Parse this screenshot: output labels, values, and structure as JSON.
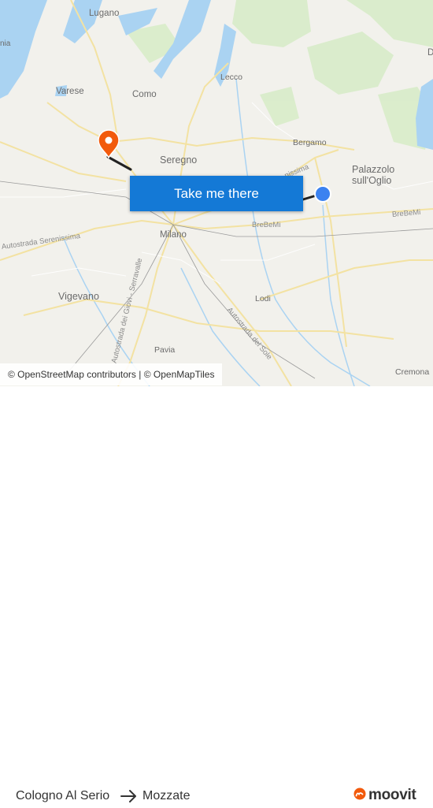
{
  "map": {
    "places": [
      {
        "id": "lugano",
        "label": "Lugano"
      },
      {
        "id": "varese",
        "label": "Varese"
      },
      {
        "id": "como",
        "label": "Como"
      },
      {
        "id": "lecco",
        "label": "Lecco"
      },
      {
        "id": "bergamo",
        "label": "Bergamo"
      },
      {
        "id": "palazzolo",
        "label": "Palazzolo\nsull'Oglio"
      },
      {
        "id": "seregno",
        "label": "Seregno"
      },
      {
        "id": "milano",
        "label": "Milano"
      },
      {
        "id": "vigevano",
        "label": "Vigevano"
      },
      {
        "id": "lodi",
        "label": "Lodi"
      },
      {
        "id": "pavia",
        "label": "Pavia"
      },
      {
        "id": "cremona",
        "label": "Cremona"
      },
      {
        "id": "edge_a",
        "label": "D"
      },
      {
        "id": "edge_b",
        "label": "nia"
      }
    ],
    "roads": [
      {
        "id": "serenissima",
        "label": "Autostrada Serenissima"
      },
      {
        "id": "serenissima_ne",
        "label": "nissima"
      },
      {
        "id": "brebemi_1",
        "label": "BreBeMi"
      },
      {
        "id": "brebemi_2",
        "label": "BreBeMi"
      },
      {
        "id": "giovi",
        "label": "Autostrada dei Giovi - Serravalle"
      },
      {
        "id": "sole",
        "label": "Autostrada del Sole"
      }
    ],
    "origin_marker": "origin-dot",
    "destination_marker": "map-pin-icon",
    "colors": {
      "water": "#aad3f2",
      "route": "#222222",
      "pin": "#f25a0c",
      "origin": "#3b82f0",
      "cta": "#1479d6"
    }
  },
  "cta": {
    "label": "Take me there"
  },
  "attribution": {
    "text": "© OpenStreetMap contributors | © OpenMapTiles"
  },
  "route": {
    "from": "Cologno Al Serio",
    "to": "Mozzate",
    "arrow_icon": "arrow-right-icon"
  },
  "brand": {
    "name": "moovit",
    "icon": "moovit-logo-icon",
    "color": "#f25a0c"
  }
}
